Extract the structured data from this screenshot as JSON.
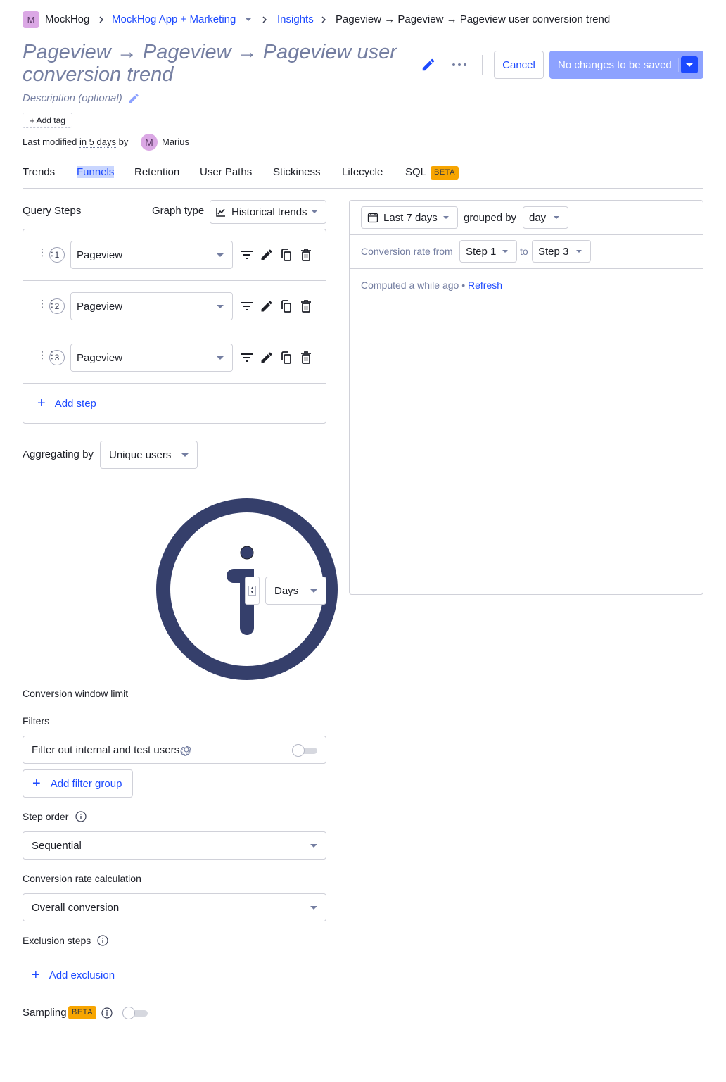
{
  "breadcrumb": {
    "org_initial": "M",
    "org_name": "MockHog",
    "project": "MockHog App + Marketing",
    "section": "Insights",
    "current": "Pageview → Pageview → Pageview user conversion trend"
  },
  "header": {
    "title": "Pageview → Pageview → Pageview user conversion trend",
    "description_placeholder": "Description (optional)",
    "add_tag": "Add tag",
    "last_modified_prefix": "Last modified",
    "last_modified_when": "in 5 days",
    "by": "by",
    "author_initial": "M",
    "author": "Marius",
    "cancel": "Cancel",
    "save": "No changes to be saved"
  },
  "tabs": [
    "Trends",
    "Funnels",
    "Retention",
    "User Paths",
    "Stickiness",
    "Lifecycle",
    "SQL"
  ],
  "tabs_active": "Funnels",
  "sql_badge": "BETA",
  "query": {
    "steps_label": "Query Steps",
    "graph_type_label": "Graph type",
    "graph_type_value": "Historical trends",
    "steps": [
      {
        "num": "1",
        "event": "Pageview"
      },
      {
        "num": "2",
        "event": "Pageview"
      },
      {
        "num": "3",
        "event": "Pageview"
      }
    ],
    "add_step": "Add step",
    "aggregating_label": "Aggregating by",
    "aggregating_value": "Unique users",
    "window_unit": "Days",
    "window_label": "Conversion window limit",
    "filters_label": "Filters",
    "filter_internal": "Filter out internal and test users",
    "add_filter_group": "Add filter group",
    "step_order_label": "Step order",
    "step_order_value": "Sequential",
    "conv_calc_label": "Conversion rate calculation",
    "conv_calc_value": "Overall conversion",
    "exclusion_label": "Exclusion steps",
    "add_exclusion": "Add exclusion",
    "sampling_label": "Sampling",
    "sampling_badge": "BETA"
  },
  "results": {
    "date_range": "Last 7 days",
    "grouped_by": "grouped by",
    "interval": "day",
    "conv_from": "Conversion rate from",
    "from_step": "Step 1",
    "to": "to",
    "to_step": "Step 3",
    "computed": "Computed a while ago",
    "bullet": "•",
    "refresh": "Refresh"
  },
  "colors": {
    "primary": "#1d4aff",
    "save_disabled": "#8da2ff",
    "beta": "#f7a501",
    "avatar": "#dba8e5",
    "illustration": "#353f6b"
  }
}
